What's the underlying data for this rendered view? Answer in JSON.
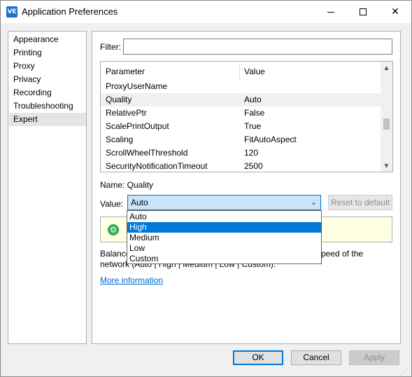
{
  "window": {
    "title": "Application Preferences",
    "app_icon_text": "VE",
    "close_glyph": "✕"
  },
  "categories": [
    {
      "label": "Appearance",
      "selected": false
    },
    {
      "label": "Printing",
      "selected": false
    },
    {
      "label": "Proxy",
      "selected": false
    },
    {
      "label": "Privacy",
      "selected": false
    },
    {
      "label": "Recording",
      "selected": false
    },
    {
      "label": "Troubleshooting",
      "selected": false
    },
    {
      "label": "Expert",
      "selected": true
    }
  ],
  "filter": {
    "label": "Filter:",
    "value": ""
  },
  "grid": {
    "headers": {
      "parameter": "Parameter",
      "value": "Value"
    },
    "rows": [
      {
        "param": "ProxyUserName",
        "value": ""
      },
      {
        "param": "Quality",
        "value": "Auto",
        "selected": true
      },
      {
        "param": "RelativePtr",
        "value": "False"
      },
      {
        "param": "ScalePrintOutput",
        "value": "True"
      },
      {
        "param": "Scaling",
        "value": "FitAutoAspect"
      },
      {
        "param": "ScrollWheelThreshold",
        "value": "120"
      },
      {
        "param": "SecurityNotificationTimeout",
        "value": "2500"
      }
    ]
  },
  "detail": {
    "name_label": "Name: Quality",
    "value_label": "Value:",
    "selected_value": "Auto",
    "reset_label": "Reset to default",
    "info_visible_text": "T",
    "description_line1": "Balance",
    "description_line1_tail": "peed of the",
    "description_line2": "network (Auto | High | Medium | Low | Custom).",
    "more_info": "More information"
  },
  "dropdown": {
    "options": [
      "Auto",
      "High",
      "Medium",
      "Low",
      "Custom"
    ],
    "highlighted": "High"
  },
  "buttons": {
    "ok": "OK",
    "cancel": "Cancel",
    "apply": "Apply"
  },
  "colors": {
    "accent": "#0078d7",
    "info_background": "#ffffe1",
    "link": "#0066cc"
  },
  "icons": [
    "app-icon",
    "minimize-icon",
    "maximize-icon",
    "close-icon",
    "scroll-up-icon",
    "scroll-down-icon",
    "chevron-down-icon",
    "gear-icon",
    "resize-grip-icon"
  ]
}
